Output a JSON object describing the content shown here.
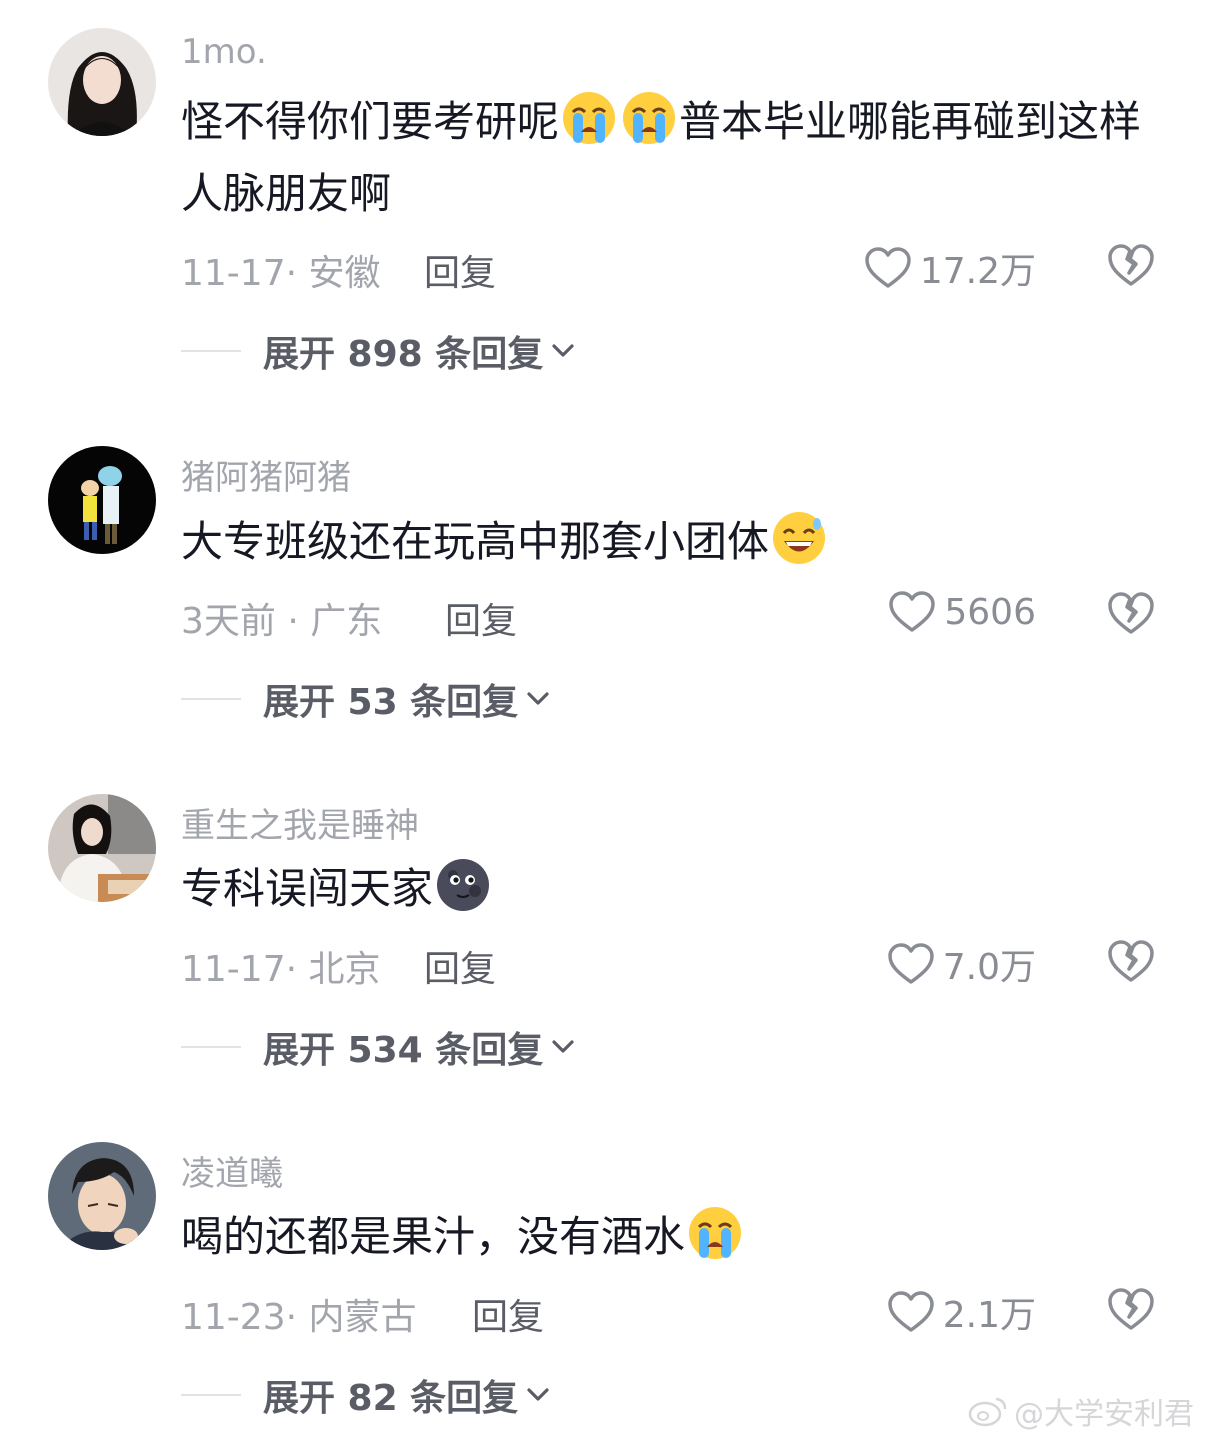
{
  "comments": [
    {
      "username": "1mo.",
      "text_a": "怪不得你们要考研呢",
      "emoji_a": "loudly-crying-face-icon",
      "emoji_b": "loudly-crying-face-icon",
      "text_b": "普本毕业哪能再碰到这样人脉朋友啊",
      "meta": "11-17· 安徽",
      "reply_label": "回复",
      "likes": "17.2万",
      "expand": "展开 898 条回复"
    },
    {
      "username": "猪阿猪阿猪",
      "text_a": "大专班级还在玩高中那套小团体",
      "emoji_a": "grinning-sweat-face-icon",
      "meta": "3天前 · 广东",
      "reply_label": "回复",
      "likes": "5606",
      "expand": "展开 53 条回复"
    },
    {
      "username": "重生之我是睡神",
      "text_a": "专科误闯天家",
      "emoji_a": "new-moon-face-icon",
      "meta": "11-17· 北京",
      "reply_label": "回复",
      "likes": "7.0万",
      "expand": "展开 534 条回复"
    },
    {
      "username": "凌道曦",
      "text_a": "喝的还都是果汁，没有酒水",
      "emoji_a": "loudly-crying-face-icon",
      "meta": "11-23· 内蒙古",
      "reply_label": "回复",
      "likes": "2.1万",
      "expand": "展开 82 条回复"
    }
  ],
  "watermark": "@大学安利君",
  "colors": {
    "muted": "#a3a5ad",
    "text": "#161823",
    "secondary": "#5b5d66"
  }
}
